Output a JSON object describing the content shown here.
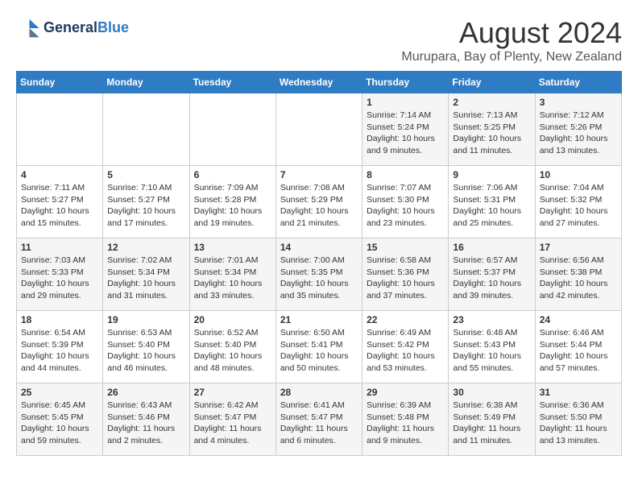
{
  "logo": {
    "line1": "General",
    "line2": "Blue"
  },
  "title": "August 2024",
  "subtitle": "Murupara, Bay of Plenty, New Zealand",
  "days_of_week": [
    "Sunday",
    "Monday",
    "Tuesday",
    "Wednesday",
    "Thursday",
    "Friday",
    "Saturday"
  ],
  "weeks": [
    [
      {
        "day": "",
        "info": ""
      },
      {
        "day": "",
        "info": ""
      },
      {
        "day": "",
        "info": ""
      },
      {
        "day": "",
        "info": ""
      },
      {
        "day": "1",
        "info": "Sunrise: 7:14 AM\nSunset: 5:24 PM\nDaylight: 10 hours\nand 9 minutes."
      },
      {
        "day": "2",
        "info": "Sunrise: 7:13 AM\nSunset: 5:25 PM\nDaylight: 10 hours\nand 11 minutes."
      },
      {
        "day": "3",
        "info": "Sunrise: 7:12 AM\nSunset: 5:26 PM\nDaylight: 10 hours\nand 13 minutes."
      }
    ],
    [
      {
        "day": "4",
        "info": "Sunrise: 7:11 AM\nSunset: 5:27 PM\nDaylight: 10 hours\nand 15 minutes."
      },
      {
        "day": "5",
        "info": "Sunrise: 7:10 AM\nSunset: 5:27 PM\nDaylight: 10 hours\nand 17 minutes."
      },
      {
        "day": "6",
        "info": "Sunrise: 7:09 AM\nSunset: 5:28 PM\nDaylight: 10 hours\nand 19 minutes."
      },
      {
        "day": "7",
        "info": "Sunrise: 7:08 AM\nSunset: 5:29 PM\nDaylight: 10 hours\nand 21 minutes."
      },
      {
        "day": "8",
        "info": "Sunrise: 7:07 AM\nSunset: 5:30 PM\nDaylight: 10 hours\nand 23 minutes."
      },
      {
        "day": "9",
        "info": "Sunrise: 7:06 AM\nSunset: 5:31 PM\nDaylight: 10 hours\nand 25 minutes."
      },
      {
        "day": "10",
        "info": "Sunrise: 7:04 AM\nSunset: 5:32 PM\nDaylight: 10 hours\nand 27 minutes."
      }
    ],
    [
      {
        "day": "11",
        "info": "Sunrise: 7:03 AM\nSunset: 5:33 PM\nDaylight: 10 hours\nand 29 minutes."
      },
      {
        "day": "12",
        "info": "Sunrise: 7:02 AM\nSunset: 5:34 PM\nDaylight: 10 hours\nand 31 minutes."
      },
      {
        "day": "13",
        "info": "Sunrise: 7:01 AM\nSunset: 5:34 PM\nDaylight: 10 hours\nand 33 minutes."
      },
      {
        "day": "14",
        "info": "Sunrise: 7:00 AM\nSunset: 5:35 PM\nDaylight: 10 hours\nand 35 minutes."
      },
      {
        "day": "15",
        "info": "Sunrise: 6:58 AM\nSunset: 5:36 PM\nDaylight: 10 hours\nand 37 minutes."
      },
      {
        "day": "16",
        "info": "Sunrise: 6:57 AM\nSunset: 5:37 PM\nDaylight: 10 hours\nand 39 minutes."
      },
      {
        "day": "17",
        "info": "Sunrise: 6:56 AM\nSunset: 5:38 PM\nDaylight: 10 hours\nand 42 minutes."
      }
    ],
    [
      {
        "day": "18",
        "info": "Sunrise: 6:54 AM\nSunset: 5:39 PM\nDaylight: 10 hours\nand 44 minutes."
      },
      {
        "day": "19",
        "info": "Sunrise: 6:53 AM\nSunset: 5:40 PM\nDaylight: 10 hours\nand 46 minutes."
      },
      {
        "day": "20",
        "info": "Sunrise: 6:52 AM\nSunset: 5:40 PM\nDaylight: 10 hours\nand 48 minutes."
      },
      {
        "day": "21",
        "info": "Sunrise: 6:50 AM\nSunset: 5:41 PM\nDaylight: 10 hours\nand 50 minutes."
      },
      {
        "day": "22",
        "info": "Sunrise: 6:49 AM\nSunset: 5:42 PM\nDaylight: 10 hours\nand 53 minutes."
      },
      {
        "day": "23",
        "info": "Sunrise: 6:48 AM\nSunset: 5:43 PM\nDaylight: 10 hours\nand 55 minutes."
      },
      {
        "day": "24",
        "info": "Sunrise: 6:46 AM\nSunset: 5:44 PM\nDaylight: 10 hours\nand 57 minutes."
      }
    ],
    [
      {
        "day": "25",
        "info": "Sunrise: 6:45 AM\nSunset: 5:45 PM\nDaylight: 10 hours\nand 59 minutes."
      },
      {
        "day": "26",
        "info": "Sunrise: 6:43 AM\nSunset: 5:46 PM\nDaylight: 11 hours\nand 2 minutes."
      },
      {
        "day": "27",
        "info": "Sunrise: 6:42 AM\nSunset: 5:47 PM\nDaylight: 11 hours\nand 4 minutes."
      },
      {
        "day": "28",
        "info": "Sunrise: 6:41 AM\nSunset: 5:47 PM\nDaylight: 11 hours\nand 6 minutes."
      },
      {
        "day": "29",
        "info": "Sunrise: 6:39 AM\nSunset: 5:48 PM\nDaylight: 11 hours\nand 9 minutes."
      },
      {
        "day": "30",
        "info": "Sunrise: 6:38 AM\nSunset: 5:49 PM\nDaylight: 11 hours\nand 11 minutes."
      },
      {
        "day": "31",
        "info": "Sunrise: 6:36 AM\nSunset: 5:50 PM\nDaylight: 11 hours\nand 13 minutes."
      }
    ]
  ]
}
